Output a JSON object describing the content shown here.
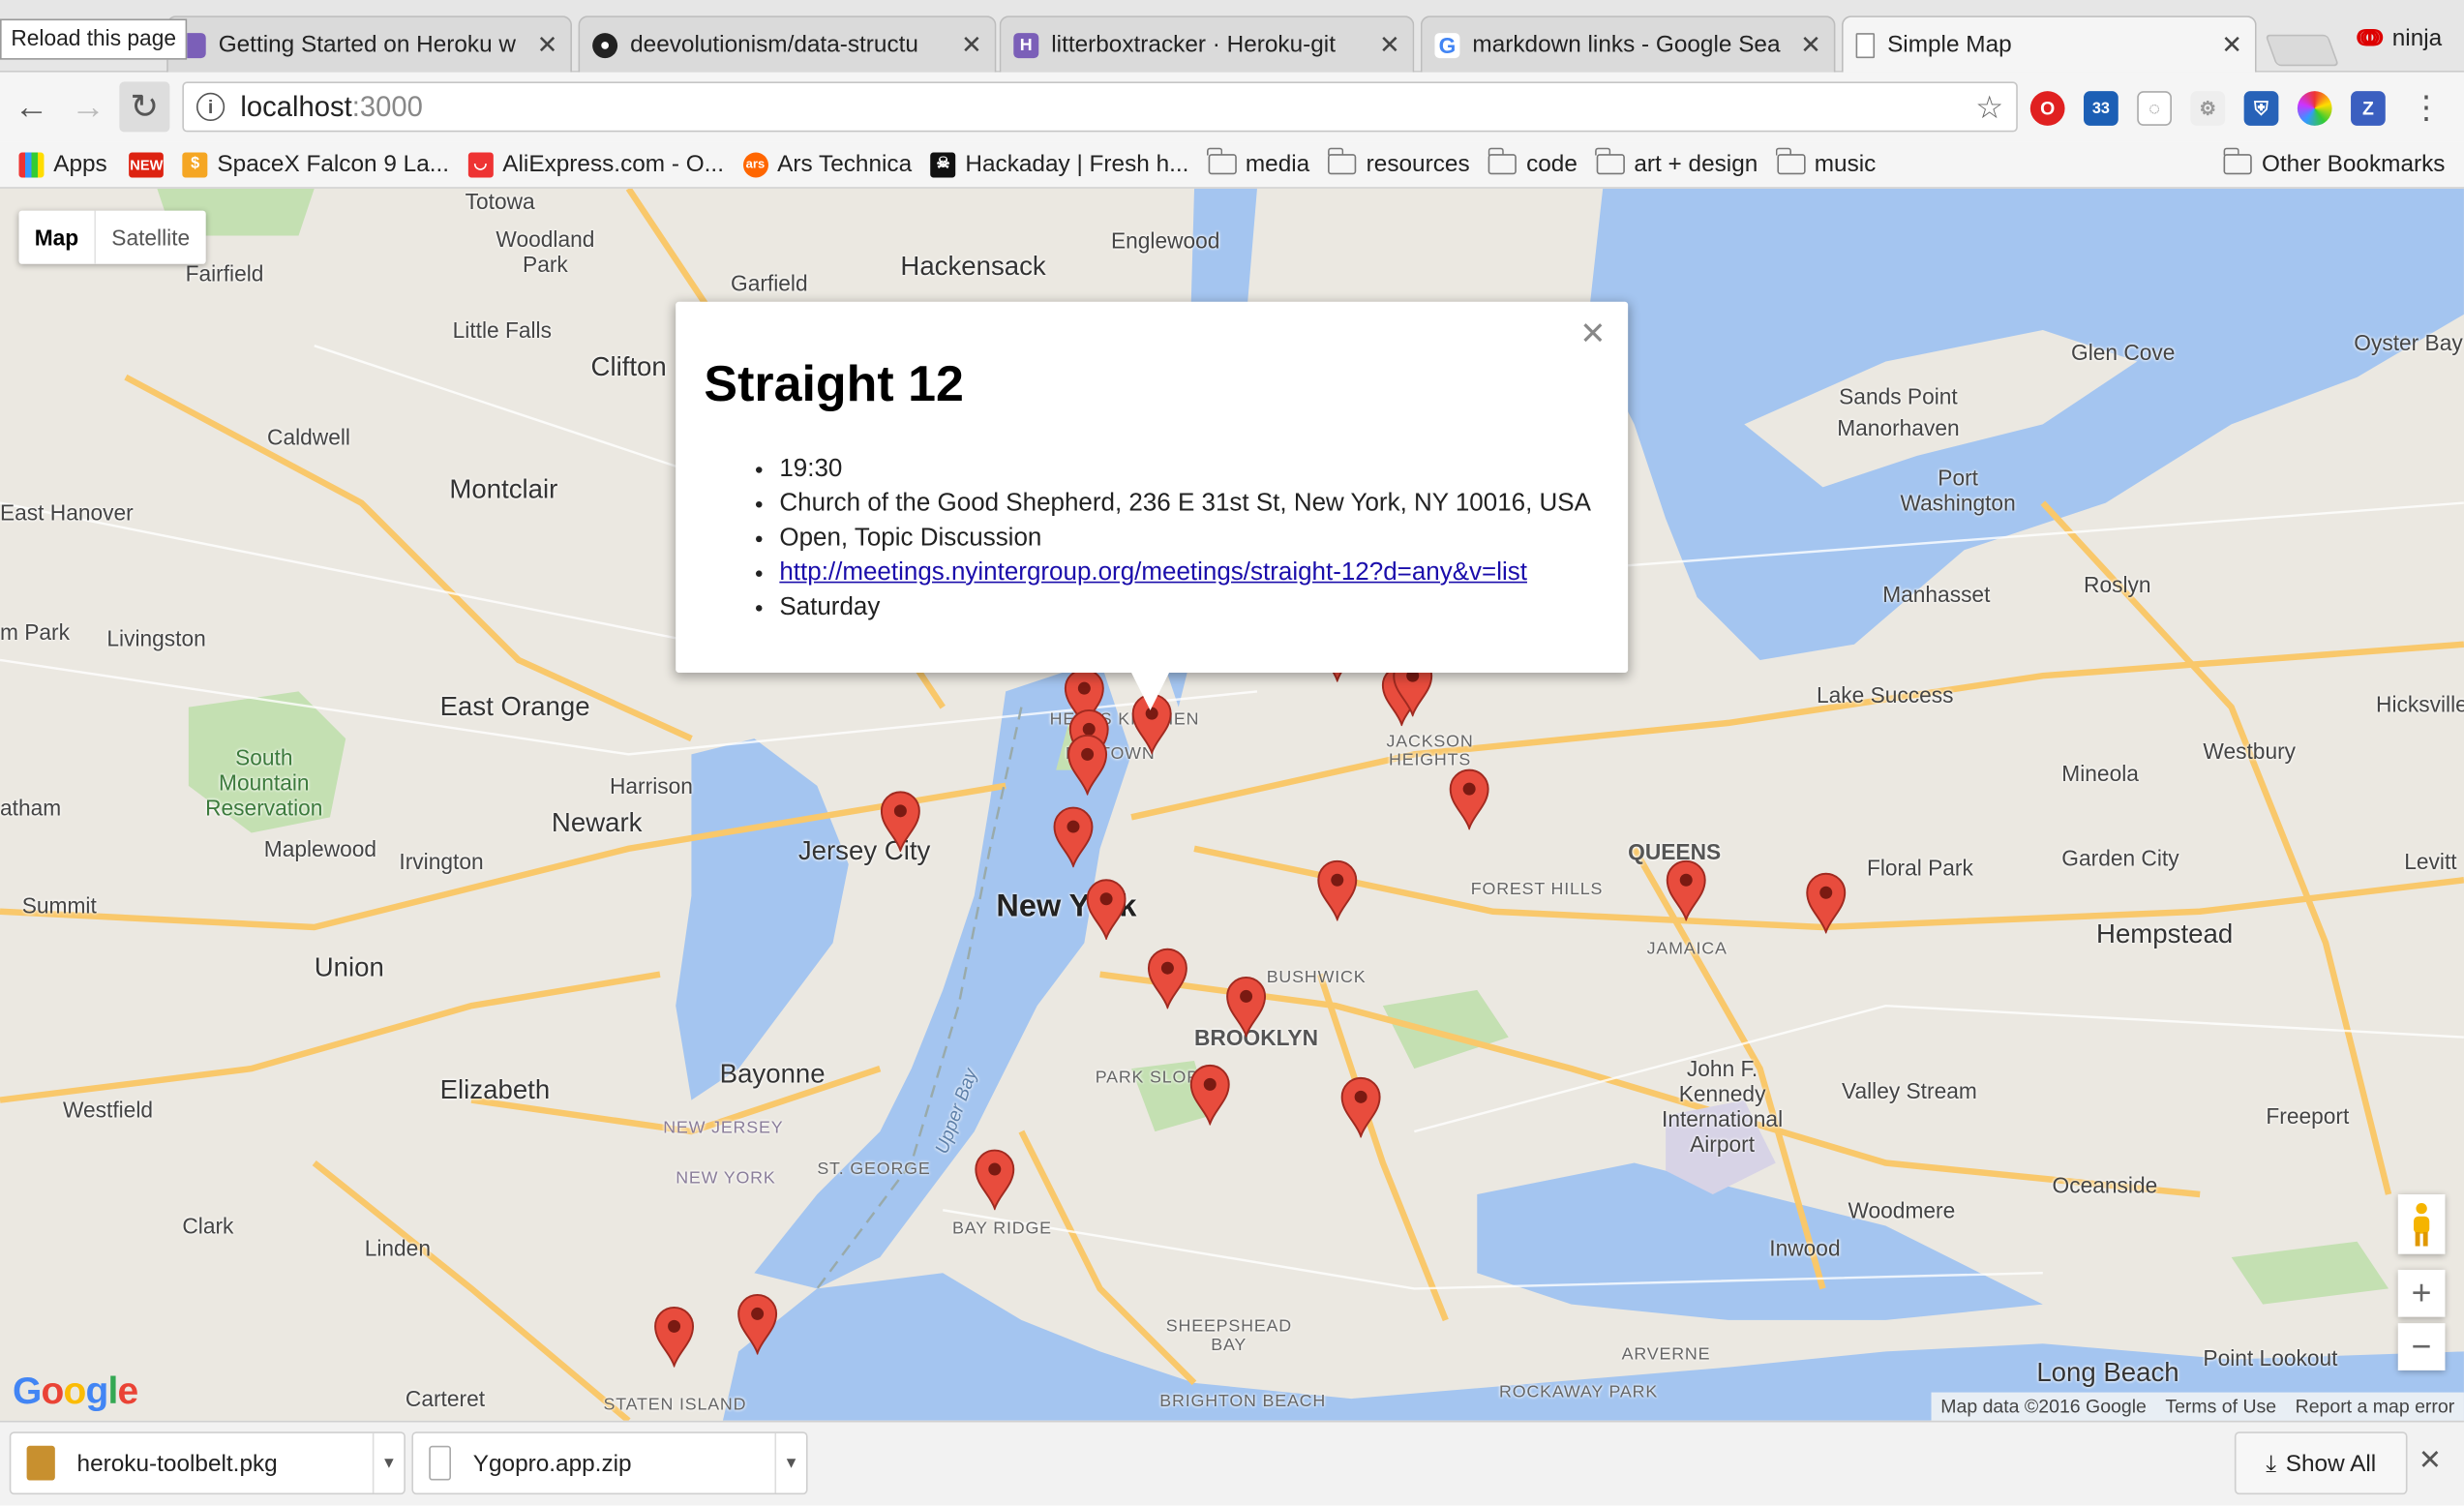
{
  "browser": {
    "tooltip": "Reload this page",
    "tabs": [
      {
        "title": "Getting Started on Heroku w",
        "icon": "heroku-icon"
      },
      {
        "title": "deevolutionism/data-structu",
        "icon": "github-icon"
      },
      {
        "title": "litterboxtracker · Heroku-git",
        "icon": "heroku-icon"
      },
      {
        "title": "markdown links - Google Sea",
        "icon": "google-icon"
      },
      {
        "title": "Simple Map",
        "icon": "page-icon"
      }
    ],
    "profile_name": "ninja",
    "url_host": "localhost",
    "url_port": ":3000",
    "extension_badge": "33"
  },
  "bookmarks": {
    "items": [
      {
        "label": "Apps"
      },
      {
        "label": "SpaceX Falcon 9 La..."
      },
      {
        "label": "AliExpress.com - O..."
      },
      {
        "label": "Ars Technica"
      },
      {
        "label": "Hackaday | Fresh h..."
      },
      {
        "label": "media"
      },
      {
        "label": "resources"
      },
      {
        "label": "code"
      },
      {
        "label": "art + design"
      },
      {
        "label": "music"
      }
    ],
    "other": "Other Bookmarks"
  },
  "map": {
    "type_map": "Map",
    "type_satellite": "Satellite",
    "attribution": "Map data ©2016 Google",
    "terms": "Terms of Use",
    "report": "Report a map error",
    "labels": {
      "newyork": "New York",
      "newark": "Newark",
      "jersey": "Jersey City",
      "clifton": "Clifton",
      "bayonne": "Bayonne",
      "elizabeth": "Elizabeth",
      "hackensack": "Hackensack",
      "englewood": "Englewood",
      "montclair": "Montclair",
      "eastorange": "East Orange",
      "irvington": "Irvington",
      "union": "Union",
      "hempstead": "Hempstead",
      "jfk": "John F. Kennedy International Airport",
      "queens": "QUEENS",
      "brooklyn": "BROOKLYN",
      "parkslope": "PARK SLOPE",
      "bushwick": "BUSHWICK",
      "jamaica": "JAMAICA",
      "foresthills": "FOREST HILLS",
      "jackson": "JACKSON HEIGHTS",
      "hellskitchen": "HELL'S KITCHEN",
      "midtown": "MIDTOWN",
      "bayridge": "BAY RIDGE",
      "sheepshead": "SHEEPSHEAD BAY",
      "brighton": "BRIGHTON BEACH",
      "rockaway": "ROCKAWAY PARK",
      "arverne": "ARVERNE",
      "longbeach": "Long Beach",
      "pointlookout": "Point Lookout",
      "oceanside": "Oceanside",
      "woodmere": "Woodmere",
      "inwood": "Inwood",
      "valleystream": "Valley Stream",
      "freeport": "Freeport",
      "floralpark": "Floral Park",
      "gardencity": "Garden City",
      "mineola": "Mineola",
      "westbury": "Westbury",
      "hicksville": "Hicksville",
      "levitt": "Levitt",
      "roslyn": "Roslyn",
      "manhasset": "Manhasset",
      "lakesuccess": "Lake Success",
      "portwashington": "Port Washington",
      "sandspoint": "Sands Point Manorhaven",
      "glencove": "Glen Cove",
      "oysterbay": "Oyster Bay",
      "fairfield": "Fairfield",
      "woodland": "Woodland Park",
      "littlefalls": "Little Falls",
      "caldwell": "Caldwell",
      "easthanover": "East Hanover",
      "livingston": "Livingston",
      "southmountain": "South Mountain Reservation",
      "harrison": "Harrison",
      "maplewood": "Maplewood",
      "summit": "Summit",
      "westfield": "Westfield",
      "clark": "Clark",
      "linden": "Linden",
      "carteret": "Carteret",
      "garfield": "Garfield",
      "totowa": "Totowa",
      "statenisland": "STATEN ISLAND",
      "stgeorge": "ST. GEORGE",
      "newjersey": "NEW JERSEY",
      "newyorkstate": "NEW YORK",
      "upperbay": "Upper Bay",
      "mpark": "m Park",
      "atham": "atham"
    }
  },
  "infowindow": {
    "title": "Straight 12",
    "time": "19:30",
    "address": "Church of the Good Shepherd, 236 E 31st St, New York, NY 10016, USA",
    "type": "Open, Topic Discussion",
    "link": "http://meetings.nyintergroup.org/meetings/straight-12?d=any&v=list",
    "day": "Saturday"
  },
  "downloads": {
    "items": [
      {
        "name": "heroku-toolbelt.pkg"
      },
      {
        "name": "Ygopro.app.zip"
      }
    ],
    "show_all": "Show All"
  },
  "colors": {
    "pin": "#e84c3d",
    "water": "#a4c5f0",
    "park": "#c4e0b2",
    "highway": "#f9c86b",
    "land": "#ebe8e1"
  }
}
